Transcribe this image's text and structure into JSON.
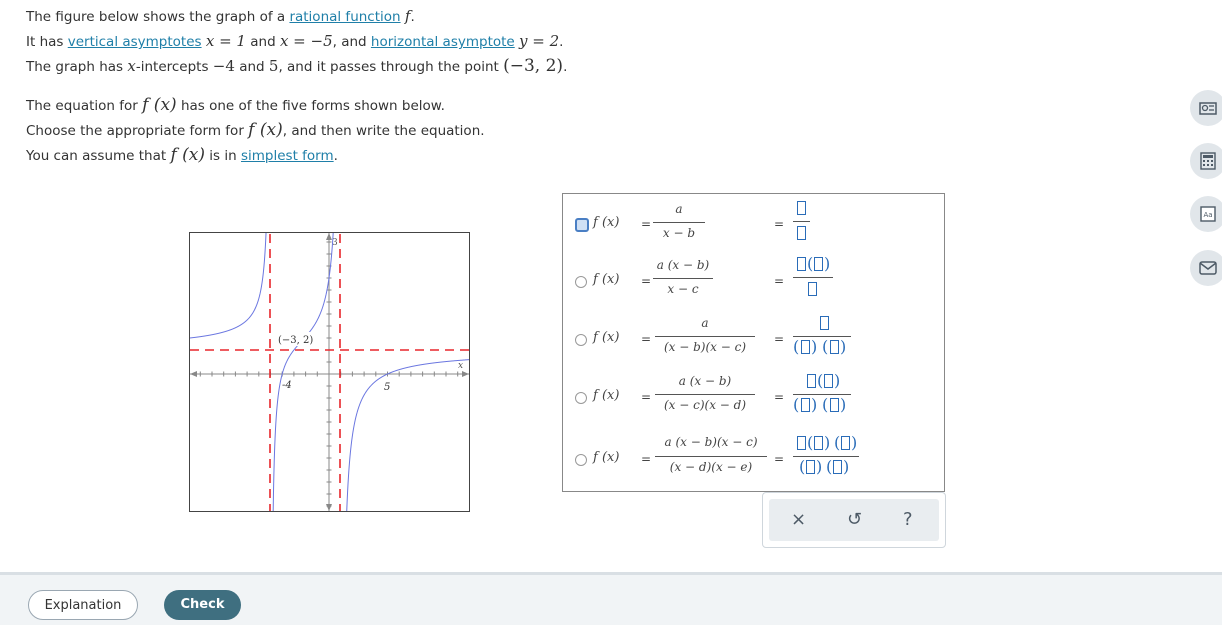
{
  "problem": {
    "l1_pre": "The figure below shows the graph of a ",
    "l1_link": "rational function",
    "l1_var": "f",
    "l1_post": ".",
    "l2_pre": "It has ",
    "l2_link1": "vertical asymptotes",
    "l2_m1": "x = 1",
    "l2_and": " and ",
    "l2_m2": "x = −5",
    "l2_mid": ", and ",
    "l2_link2": "horizontal asymptote",
    "l2_m3": "y = 2",
    "l2_post": ".",
    "l3_pre": "The graph has ",
    "l3_var": "x",
    "l3_mid": "-intercepts ",
    "l3_m1": "−4",
    "l3_and": " and ",
    "l3_m2": "5",
    "l3_mid2": ", and it passes through the point ",
    "l3_pt": "(−3, 2)",
    "l3_post": ".",
    "l4_pre": "The equation for ",
    "l4_fx": "f (x)",
    "l4_post": " has one of the five forms shown below.",
    "l5_pre": "Choose the appropriate form for ",
    "l5_fx": "f (x)",
    "l5_post": ", and then write the equation.",
    "l6_pre": "You can assume that ",
    "l6_fx": "f (x)",
    "l6_mid": " is in ",
    "l6_link": "simplest form",
    "l6_post": "."
  },
  "graph": {
    "y_tick_label": "3",
    "x_axis_label": "x",
    "point_label": "(−3, 2)",
    "xint_label_1": "-4",
    "xint_label_2": "5",
    "asymptote_color": "#e8262b",
    "curve_color": "#6a76e0"
  },
  "forms": {
    "fx": "f (x)",
    "eq": "=",
    "rows": [
      {
        "num": "a",
        "den": "x − b",
        "selected": true
      },
      {
        "num": "a (x − b)",
        "den": "x − c",
        "selected": false
      },
      {
        "num": "a",
        "den": "(x − b)(x − c)",
        "selected": false
      },
      {
        "num": "a (x − b)",
        "den": "(x − c)(x − d)",
        "selected": false
      },
      {
        "num": "a (x − b)(x − c)",
        "den": "(x − d)(x − e)",
        "selected": false
      }
    ],
    "selected_color": "#4a7fc4"
  },
  "toolbar": {
    "clear": "×",
    "undo": "↺",
    "help": "?"
  },
  "side_tools": [
    "table-icon",
    "calculator-icon",
    "glossary-icon",
    "message-icon"
  ],
  "side_glossary_text": "Aa",
  "buttons": {
    "explanation": "Explanation",
    "check": "Check"
  }
}
